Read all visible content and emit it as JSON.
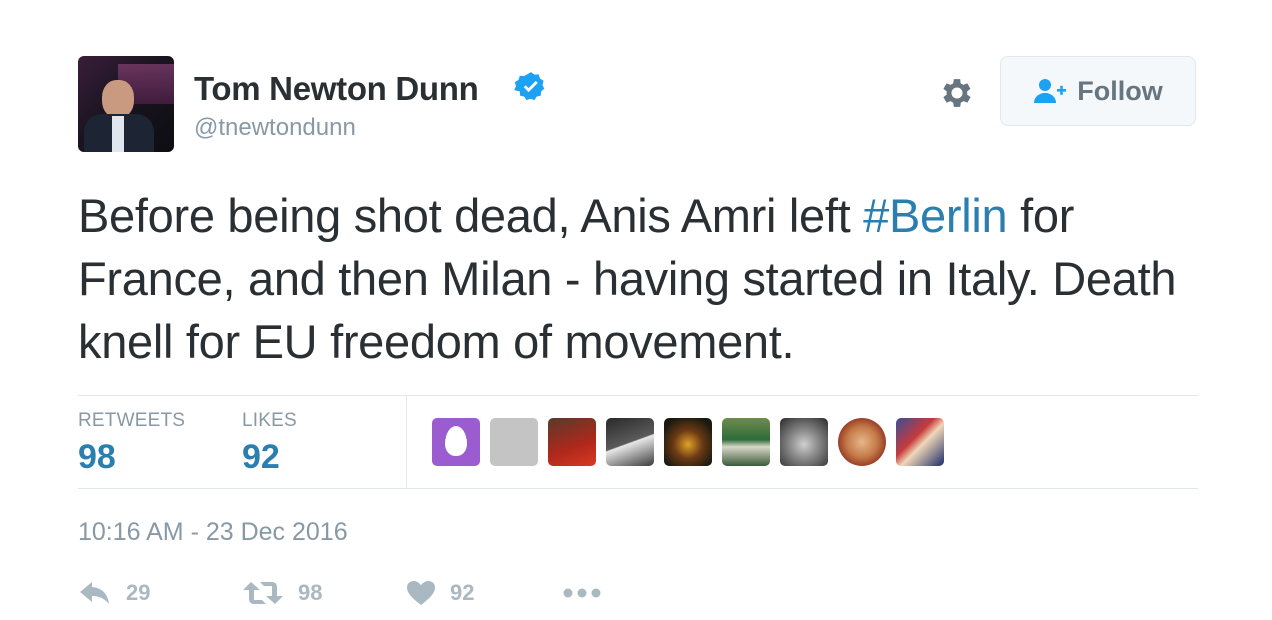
{
  "user": {
    "name": "Tom Newton Dunn",
    "handle": "@tnewtondunn",
    "verified": true
  },
  "follow_button": {
    "label": "Follow"
  },
  "tweet": {
    "text_before": "Before being shot dead, Anis Amri left ",
    "hashtag": "#Berlin",
    "text_after": " for France, and then Milan - having started in Italy. Death knell for EU freedom of movement."
  },
  "stats": {
    "retweets_label": "RETWEETS",
    "retweets_count": "98",
    "likes_label": "LIKES",
    "likes_count": "92"
  },
  "timestamp": "10:16 AM - 23 Dec 2016",
  "actions": {
    "reply_count": "29",
    "retweet_count": "98",
    "like_count": "92"
  },
  "colors": {
    "link": "#2a7fb0",
    "verified": "#1da1f2",
    "muted": "#8899a6"
  }
}
